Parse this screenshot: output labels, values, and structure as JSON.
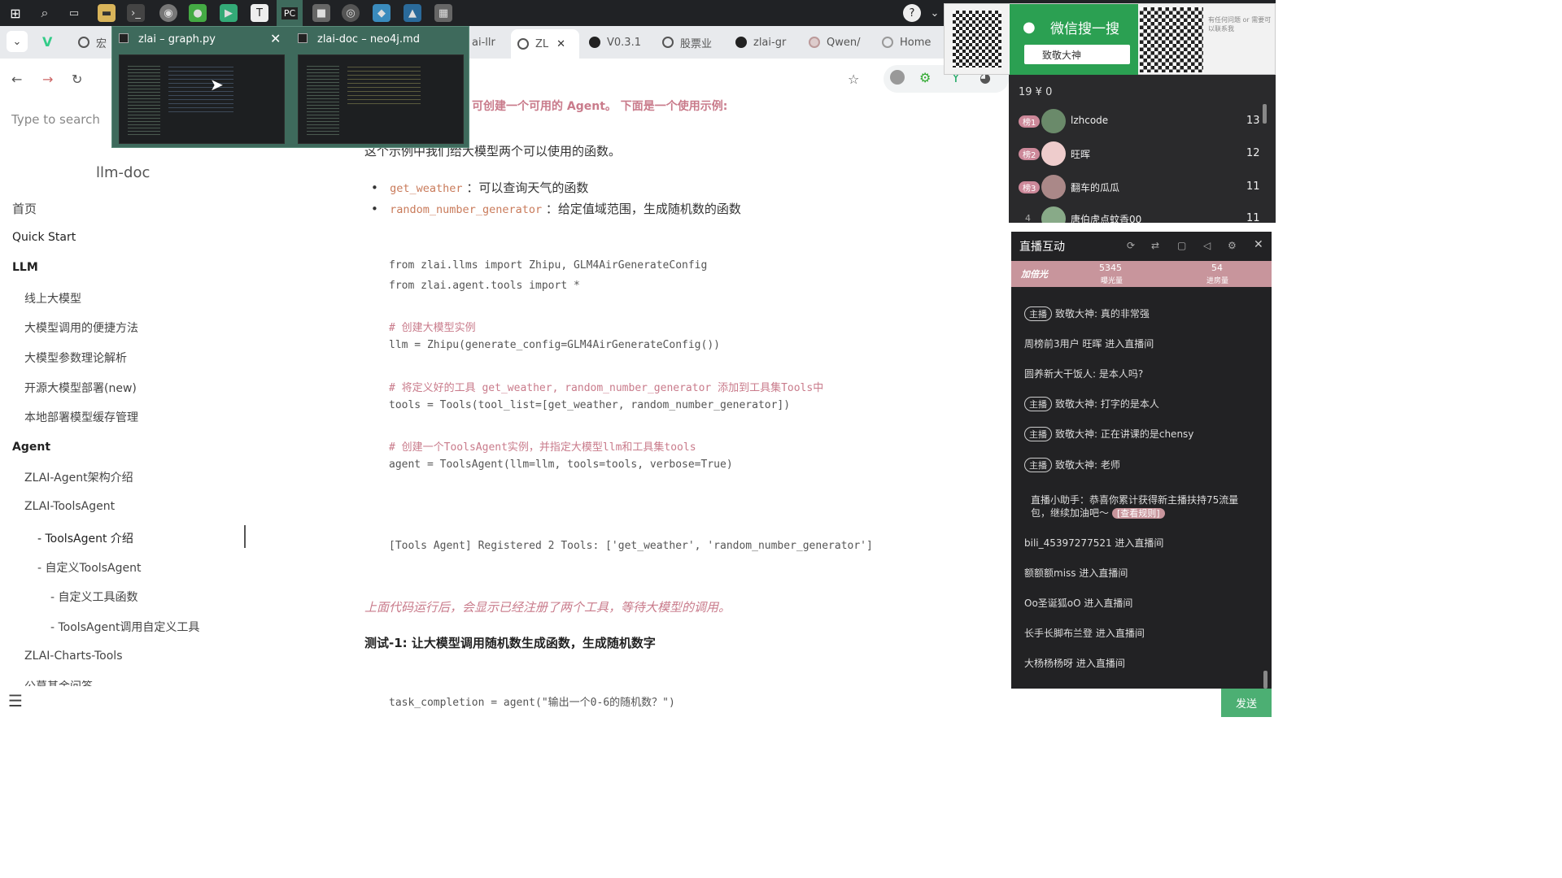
{
  "taskbar": {
    "icons": [
      "windows-icon",
      "search-icon",
      "task-view-icon",
      "file-explorer-icon",
      "terminal-icon",
      "chrome-icon",
      "wechat-icon",
      "app-icon",
      "typora-icon",
      "pycharm-icon",
      "app2-icon",
      "obs-icon",
      "app3-icon",
      "app4-icon",
      "app5-icon"
    ]
  },
  "tabs": [
    {
      "label": "宏"
    },
    {
      "label": "ai-llr"
    },
    {
      "label": "ZL"
    },
    {
      "label": "V0.3.1"
    },
    {
      "label": "股票业"
    },
    {
      "label": "zlai-gr"
    },
    {
      "label": "Qwen/"
    },
    {
      "label": "Home"
    }
  ],
  "preview": {
    "win1_title": "zlai – graph.py",
    "win2_title": "zlai-doc – neo4j.md"
  },
  "sidebar": {
    "search_placeholder": "Type to search",
    "site_title": "llm-doc",
    "items": [
      {
        "label": "首页",
        "level": 0
      },
      {
        "label": "Quick Start",
        "level": 0
      },
      {
        "label": "LLM",
        "level": 0
      },
      {
        "label": "线上大模型",
        "level": 1
      },
      {
        "label": "大模型调用的便捷方法",
        "level": 1
      },
      {
        "label": "大模型参数理论解析",
        "level": 1
      },
      {
        "label": "开源大模型部署(new)",
        "level": 1
      },
      {
        "label": "本地部署模型缓存管理",
        "level": 1
      },
      {
        "label": "Agent",
        "level": 0
      },
      {
        "label": "ZLAI-Agent架构介绍",
        "level": 1
      },
      {
        "label": "ZLAI-ToolsAgent",
        "level": 1
      },
      {
        "label": "- ToolsAgent 介绍",
        "level": 2
      },
      {
        "label": "- 自定义ToolsAgent",
        "level": 2
      },
      {
        "label": "- 自定义工具函数",
        "level": 3
      },
      {
        "label": "- ToolsAgent调用自定义工具",
        "level": 3
      },
      {
        "label": "ZLAI-Charts-Tools",
        "level": 1
      },
      {
        "label": "公募基金问答",
        "level": 1
      }
    ]
  },
  "content": {
    "intro_tail": "可创建一个可用的 Agent。 下面是一个使用示例:",
    "example_desc": "这个示例中我们给大模型两个可以使用的函数。",
    "bullets": [
      {
        "code": "get_weather",
        "text": "：可以查询天气的函数"
      },
      {
        "code": "random_number_generator",
        "text": "：给定值域范围，生成随机数的函数"
      }
    ],
    "code_lines": [
      "from zlai.llms import Zhipu, GLM4AirGenerateConfig",
      "from zlai.agent.tools import *",
      "",
      "# 创建大模型实例",
      "llm = Zhipu(generate_config=GLM4AirGenerateConfig())",
      "",
      "# 将定义好的工具 get_weather, random_number_generator 添加到工具集Tools中",
      "tools = Tools(tool_list=[get_weather, random_number_generator])",
      "",
      "# 创建一个ToolsAgent实例，并指定大模型llm和工具集tools",
      "agent = ToolsAgent(llm=llm, tools=tools, verbose=True)"
    ],
    "output_line": "[Tools Agent] Registered 2 Tools: ['get_weather', 'random_number_generator']",
    "italic_note": "上面代码运行后，会显示已经注册了两个工具，等待大模型的调用。",
    "test_heading": "测试-1: 让大模型调用随机数生成函数，生成随机数字",
    "task_line": "task_completion = agent(\"输出一个0-6的随机数？\")"
  },
  "qr_panel": {
    "title": "微信搜一搜",
    "search_text": "致敬大神",
    "side_note": "有任何问题 or 需要可以联系我"
  },
  "rank": {
    "stats": "19  ¥ 0",
    "rows": [
      {
        "badge": "榜1",
        "name": "lzhcode",
        "score": "13"
      },
      {
        "badge": "榜2",
        "name": "旺晖",
        "score": "12"
      },
      {
        "badge": "榜3",
        "name": "翻车的瓜瓜",
        "score": "11"
      },
      {
        "badge": "4",
        "name": "唐伯虎点蚊香00",
        "score": "11"
      }
    ]
  },
  "live": {
    "title": "直播互动",
    "fans_label": "加倍光",
    "stat1_value": "5345",
    "stat1_label": "曝光量",
    "stat2_value": "54",
    "stat2_label": "进房量",
    "messages": [
      {
        "host": "主播",
        "text": "致敬大神: 真的非常强"
      },
      {
        "host": "",
        "text": "周榜前3用户 旺晖 进入直播间"
      },
      {
        "host": "",
        "text": "圆养新大干饭人: 是本人吗?"
      },
      {
        "host": "主播",
        "text": "致敬大神: 打字的是本人"
      },
      {
        "host": "主播",
        "text": "致敬大神: 正在讲课的是chensy"
      },
      {
        "host": "主播",
        "text": "致敬大神: 老师"
      },
      {
        "host": "",
        "text": "直播小助手：恭喜你累计获得新主播扶持75流量包，继续加油吧～"
      },
      {
        "host": "",
        "text": "bili_45397277521 进入直播间"
      },
      {
        "host": "",
        "text": "额额额miss 进入直播间"
      },
      {
        "host": "",
        "text": "Oo圣诞狐oO 进入直播间"
      },
      {
        "host": "",
        "text": "长手长脚布兰登 进入直播间"
      },
      {
        "host": "",
        "text": "大杨杨杨呀 进入直播间"
      }
    ],
    "rules_button": "[查看规则]",
    "send_button": "发送"
  }
}
